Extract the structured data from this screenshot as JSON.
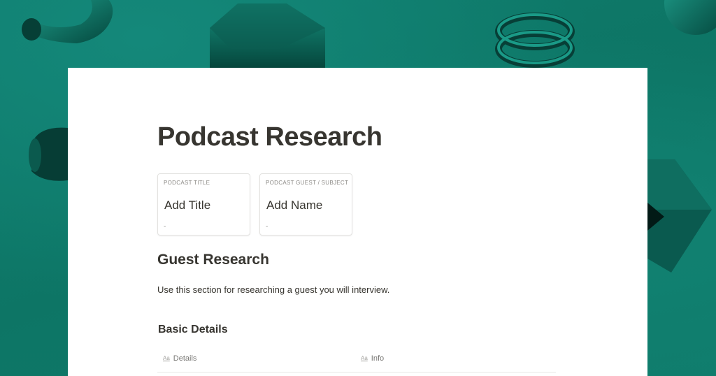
{
  "page": {
    "title": "Podcast Research"
  },
  "properties": [
    {
      "label": "PODCAST TITLE",
      "value": "Add Title",
      "sub": "-"
    },
    {
      "label": "PODCAST GUEST / SUBJECT",
      "value": "Add Name",
      "sub": "-"
    }
  ],
  "section": {
    "heading": "Guest Research",
    "description": "Use this section for researching a guest you will interview."
  },
  "basic_details": {
    "heading": "Basic Details",
    "columns": [
      {
        "icon": "text-property-icon",
        "icon_text": "Aa",
        "label": "Details"
      },
      {
        "icon": "text-property-icon",
        "icon_text": "Aa",
        "label": "Info"
      }
    ]
  },
  "colors": {
    "background": "#0f7a6a",
    "page": "#ffffff",
    "text": "#373530"
  }
}
